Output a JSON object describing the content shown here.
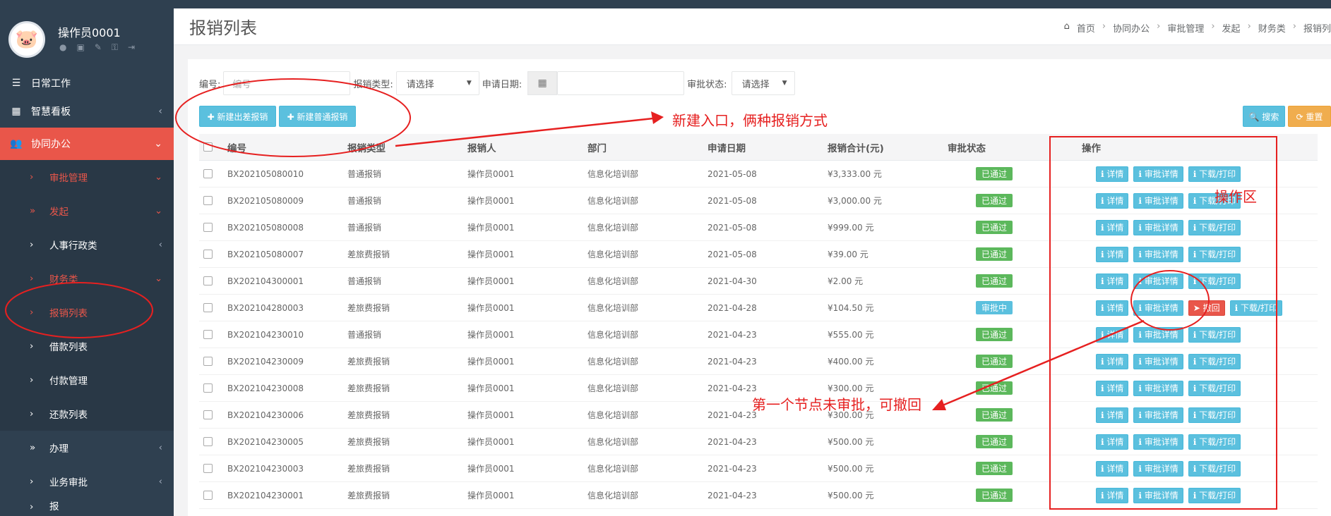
{
  "user": {
    "name": "操作员0001",
    "avatar_emoji": "🐷"
  },
  "profile_icons": [
    "user-icon",
    "id-card-icon",
    "edit-icon",
    "key-icon",
    "logout-icon"
  ],
  "menu": {
    "daily": "日常工作",
    "dashboard": "智慧看板",
    "collab": "协同办公",
    "approval_mgmt": "审批管理",
    "initiate": "发起",
    "hr": "人事行政类",
    "finance": "财务类",
    "expense_list": "报销列表",
    "loan_list": "借款列表",
    "payment_mgmt": "付款管理",
    "repay_list": "还款列表",
    "handle": "办理",
    "biz_audit": "业务审批",
    "more": "报",
    "arrow_left": "‹",
    "arrow_down": "⌄",
    "arrow_right": "›",
    "arrow_double": "»"
  },
  "header": {
    "title": "报销列表",
    "breadcrumb": [
      "首页",
      "协同办公",
      "审批管理",
      "发起",
      "财务类",
      "报销列"
    ]
  },
  "filters": {
    "code_label": "编号:",
    "code_placeholder": "编号",
    "type_label": "报销类型:",
    "type_value": "请选择",
    "date_label": "申请日期:",
    "status_label": "审批状态:",
    "status_value": "请选择"
  },
  "buttons": {
    "new_travel": "✚ 新建出差报销",
    "new_normal": "✚ 新建普通报销",
    "search": "🔍 搜索",
    "reset": "⟳ 重置"
  },
  "table": {
    "headers": [
      "编号",
      "报销类型",
      "报销人",
      "部门",
      "申请日期",
      "报销合计(元)",
      "审批状态",
      "操作"
    ],
    "rows": [
      {
        "code": "BX202105080010",
        "type": "普通报销",
        "person": "操作员0001",
        "dept": "信息化培训部",
        "date": "2021-05-08",
        "amount": "¥3,333.00 元",
        "status": "已通过",
        "status_color": "#5cb85c"
      },
      {
        "code": "BX202105080009",
        "type": "普通报销",
        "person": "操作员0001",
        "dept": "信息化培训部",
        "date": "2021-05-08",
        "amount": "¥3,000.00 元",
        "status": "已通过",
        "status_color": "#5cb85c"
      },
      {
        "code": "BX202105080008",
        "type": "普通报销",
        "person": "操作员0001",
        "dept": "信息化培训部",
        "date": "2021-05-08",
        "amount": "¥999.00 元",
        "status": "已通过",
        "status_color": "#5cb85c"
      },
      {
        "code": "BX202105080007",
        "type": "差旅费报销",
        "person": "操作员0001",
        "dept": "信息化培训部",
        "date": "2021-05-08",
        "amount": "¥39.00 元",
        "status": "已通过",
        "status_color": "#5cb85c"
      },
      {
        "code": "BX202104300001",
        "type": "普通报销",
        "person": "操作员0001",
        "dept": "信息化培训部",
        "date": "2021-04-30",
        "amount": "¥2.00 元",
        "status": "已通过",
        "status_color": "#5cb85c"
      },
      {
        "code": "BX202104280003",
        "type": "差旅费报销",
        "person": "操作员0001",
        "dept": "信息化培训部",
        "date": "2021-04-28",
        "amount": "¥104.50 元",
        "status": "审批中",
        "status_color": "#5bc0de",
        "revocable": true
      },
      {
        "code": "BX202104230010",
        "type": "普通报销",
        "person": "操作员0001",
        "dept": "信息化培训部",
        "date": "2021-04-23",
        "amount": "¥555.00 元",
        "status": "已通过",
        "status_color": "#5cb85c"
      },
      {
        "code": "BX202104230009",
        "type": "差旅费报销",
        "person": "操作员0001",
        "dept": "信息化培训部",
        "date": "2021-04-23",
        "amount": "¥400.00 元",
        "status": "已通过",
        "status_color": "#5cb85c"
      },
      {
        "code": "BX202104230008",
        "type": "差旅费报销",
        "person": "操作员0001",
        "dept": "信息化培训部",
        "date": "2021-04-23",
        "amount": "¥300.00 元",
        "status": "已通过",
        "status_color": "#5cb85c"
      },
      {
        "code": "BX202104230006",
        "type": "差旅费报销",
        "person": "操作员0001",
        "dept": "信息化培训部",
        "date": "2021-04-23",
        "amount": "¥300.00 元",
        "status": "已通过",
        "status_color": "#5cb85c"
      },
      {
        "code": "BX202104230005",
        "type": "差旅费报销",
        "person": "操作员0001",
        "dept": "信息化培训部",
        "date": "2021-04-23",
        "amount": "¥500.00 元",
        "status": "已通过",
        "status_color": "#5cb85c"
      },
      {
        "code": "BX202104230003",
        "type": "差旅费报销",
        "person": "操作员0001",
        "dept": "信息化培训部",
        "date": "2021-04-23",
        "amount": "¥500.00 元",
        "status": "已通过",
        "status_color": "#5cb85c"
      },
      {
        "code": "BX202104230001",
        "type": "差旅费报销",
        "person": "操作员0001",
        "dept": "信息化培训部",
        "date": "2021-04-23",
        "amount": "¥500.00 元",
        "status": "已通过",
        "status_color": "#5cb85c"
      }
    ],
    "ops": {
      "detail": "ℹ 详情",
      "audit_detail": "ℹ 审批详情",
      "download": "ℹ 下载/打印",
      "revoke": "➤ 撤回"
    }
  },
  "annotations": {
    "new_entry": "新建入口，俩种报销方式",
    "op_area": "操作区",
    "revoke_note": "第一个节点未审批，可撤回",
    "color": "#e62020"
  }
}
